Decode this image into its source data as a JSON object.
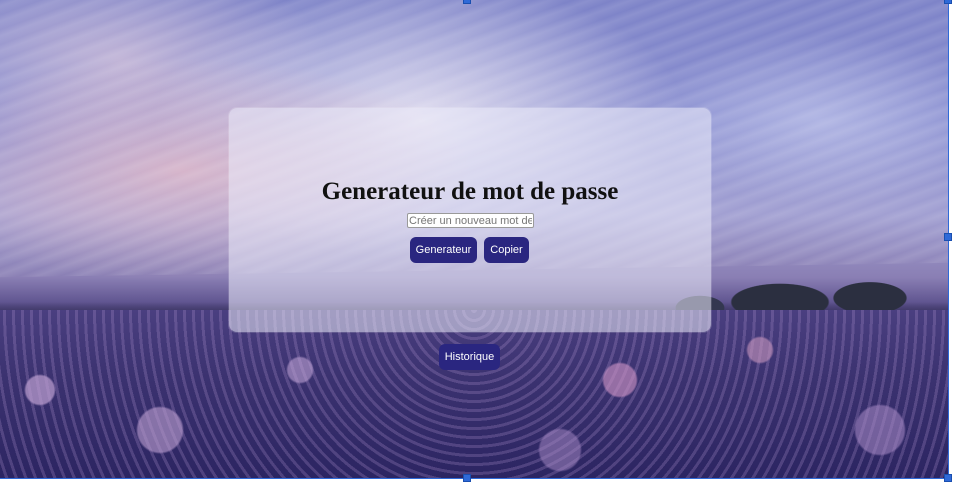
{
  "card": {
    "title": "Generateur de mot de passe",
    "password_placeholder": "Créer un nouveau mot de passe",
    "password_value": "",
    "generate_label": "Generateur",
    "copy_label": "Copier"
  },
  "footer": {
    "history_label": "Historique"
  },
  "colors": {
    "button_bg": "#2a2680",
    "button_text": "#ffffff",
    "selection_handle": "#2f6ad8"
  }
}
